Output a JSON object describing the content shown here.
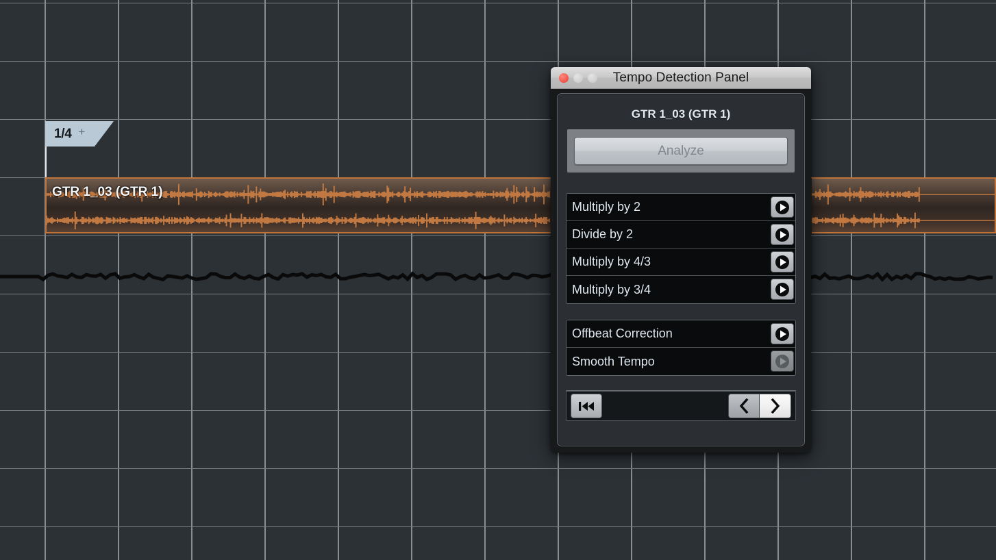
{
  "window": {
    "title": "Tempo Detection Panel",
    "traffic_lights": [
      {
        "name": "close-button",
        "color": "#f0524a",
        "enabled": true
      },
      {
        "name": "minimize-button",
        "color": "#cfcfcf",
        "enabled": false
      },
      {
        "name": "zoom-button",
        "color": "#cfcfcf",
        "enabled": false
      }
    ]
  },
  "panel": {
    "region_title": "GTR 1_03 (GTR 1)",
    "analyze": {
      "label": "Analyze",
      "enabled": false
    },
    "multiply_group": [
      {
        "label": "Multiply by 2",
        "action_icon": "play-icon",
        "enabled": true
      },
      {
        "label": "Divide by 2",
        "action_icon": "play-icon",
        "enabled": true
      },
      {
        "label": "Multiply by 4/3",
        "action_icon": "play-icon",
        "enabled": true
      },
      {
        "label": "Multiply by 3/4",
        "action_icon": "play-icon",
        "enabled": true
      }
    ],
    "correction_group": [
      {
        "label": "Offbeat Correction",
        "action_icon": "play-icon",
        "enabled": true
      },
      {
        "label": "Smooth Tempo",
        "action_icon": "play-icon",
        "enabled": false
      }
    ],
    "transport": {
      "rewind_icon": "rewind-to-start-icon",
      "prev_icon": "chevron-left-icon",
      "next_icon": "chevron-right-icon",
      "next_highlighted": true
    }
  },
  "arrange": {
    "tempo_marker": {
      "value": "1/4",
      "plus": "+"
    },
    "region_name": "GTR 1_03 (GTR 1)",
    "region_color": "#c0743a",
    "background_color": "#2c3136",
    "gridline_color": "#878d90",
    "tempo_curve_color": "#0a0a0a"
  }
}
